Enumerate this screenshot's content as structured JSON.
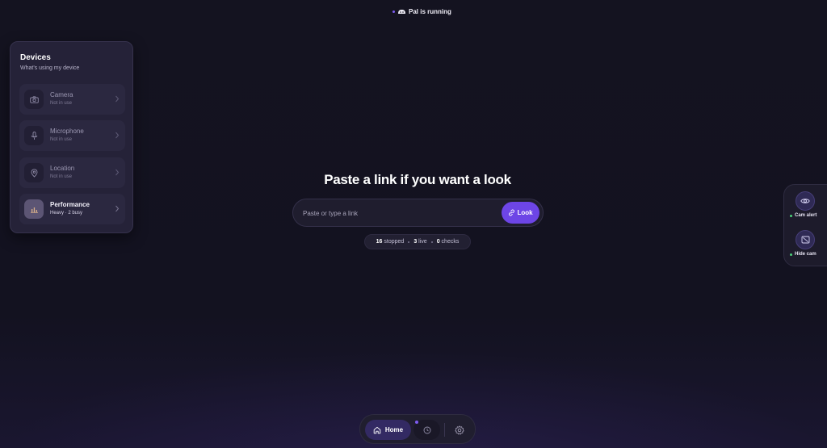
{
  "status": {
    "text": "Pal is running",
    "icon": "pal-icon",
    "dot_color": "#7d5cf0"
  },
  "devices": {
    "title": "Devices",
    "subtitle": "What's using my device",
    "items": [
      {
        "name": "Camera",
        "state": "Not in use",
        "icon": "camera-icon"
      },
      {
        "name": "Microphone",
        "state": "Not in use",
        "icon": "microphone-icon"
      },
      {
        "name": "Location",
        "state": "Not in use",
        "icon": "location-icon"
      },
      {
        "name": "Performance",
        "state": "Heavy · 2 busy",
        "icon": "performance-icon"
      }
    ]
  },
  "main": {
    "heading": "Paste a link if you want a look",
    "search": {
      "placeholder": "Paste or type a link",
      "value": ""
    },
    "look_button": "Look",
    "stats": {
      "stopped_count": "16",
      "stopped_label": "stopped",
      "live_count": "3",
      "live_label": "live",
      "checks_count": "0",
      "checks_label": "checks"
    }
  },
  "rail": {
    "items": [
      {
        "label": "Cam alert",
        "icon": "eye-icon"
      },
      {
        "label": "Hide cam",
        "icon": "hide-camera-icon"
      }
    ]
  },
  "nav": {
    "home_label": "Home",
    "history_icon": "clock-icon",
    "settings_icon": "gear-icon"
  },
  "colors": {
    "accent": "#6d45e6",
    "background": "#141320",
    "panel": "#252238",
    "online": "#4ad07a"
  }
}
